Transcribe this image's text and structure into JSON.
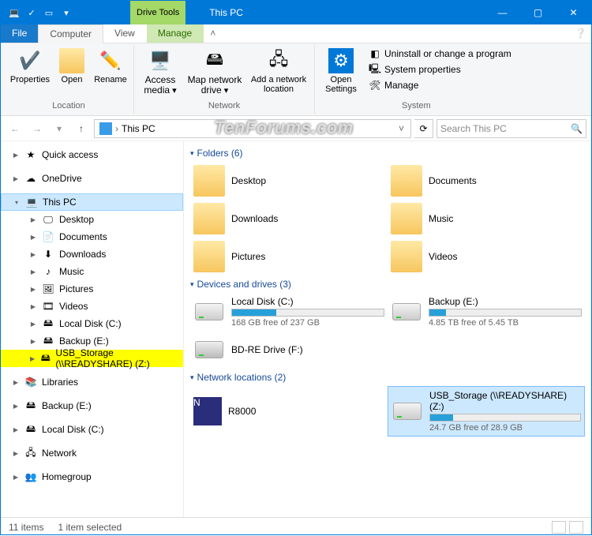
{
  "window": {
    "title": "This PC",
    "contextual_tab": "Drive Tools",
    "min": "—",
    "max": "▢",
    "close": "✕"
  },
  "tabs": {
    "file": "File",
    "computer": "Computer",
    "view": "View",
    "manage": "Manage"
  },
  "ribbon": {
    "location": {
      "properties": "Properties",
      "open": "Open",
      "rename": "Rename",
      "label": "Location"
    },
    "network": {
      "access_media": "Access media",
      "map_drive": "Map network drive",
      "add_location": "Add a network location",
      "label": "Network"
    },
    "system": {
      "open_settings": "Open Settings",
      "uninstall": "Uninstall or change a program",
      "sys_props": "System properties",
      "manage": "Manage",
      "label": "System"
    }
  },
  "address": {
    "crumb_root": "",
    "crumb": "This PC",
    "refresh": "⟳",
    "search_placeholder": "Search This PC"
  },
  "nav": {
    "quick_access": "Quick access",
    "onedrive": "OneDrive",
    "this_pc": "This PC",
    "desktop": "Desktop",
    "documents": "Documents",
    "downloads": "Downloads",
    "music": "Music",
    "pictures": "Pictures",
    "videos": "Videos",
    "local_c": "Local Disk (C:)",
    "backup_e": "Backup (E:)",
    "usb_storage": "USB_Storage (\\\\READYSHARE) (Z:)",
    "libraries": "Libraries",
    "backup_e2": "Backup (E:)",
    "local_c2": "Local Disk (C:)",
    "network": "Network",
    "homegroup": "Homegroup"
  },
  "content": {
    "folders_hdr": "Folders (6)",
    "devices_hdr": "Devices and drives (3)",
    "netloc_hdr": "Network locations (2)",
    "folders": {
      "desktop": "Desktop",
      "documents": "Documents",
      "downloads": "Downloads",
      "music": "Music",
      "pictures": "Pictures",
      "videos": "Videos"
    },
    "drives": {
      "c": {
        "name": "Local Disk (C:)",
        "free": "168 GB free of 237 GB",
        "pct": 29
      },
      "e": {
        "name": "Backup (E:)",
        "free": "4.85 TB free of 5.45 TB",
        "pct": 11
      },
      "f": {
        "name": "BD-RE Drive (F:)"
      }
    },
    "net": {
      "r8000": "R8000",
      "usb": {
        "name": "USB_Storage (\\\\READYSHARE) (Z:)",
        "free": "24.7 GB free of 28.9 GB",
        "pct": 15
      }
    }
  },
  "status": {
    "items": "11 items",
    "selected": "1 item selected"
  },
  "watermark": "TenForums.com"
}
